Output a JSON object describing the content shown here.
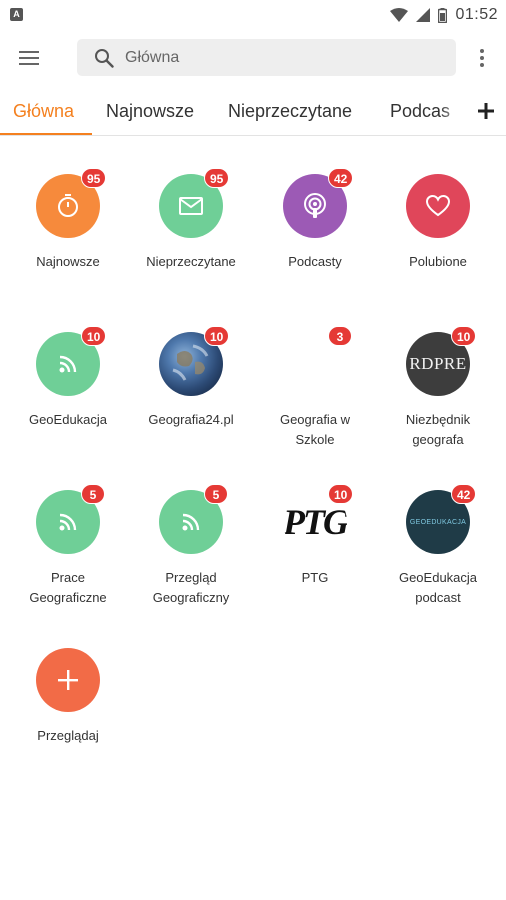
{
  "status_bar": {
    "time": "01:52",
    "left_icon_letter": "A"
  },
  "search": {
    "placeholder": "Główna"
  },
  "tabs": [
    {
      "label": "Główna"
    },
    {
      "label": "Najnowsze"
    },
    {
      "label": "Nieprzeczytane"
    },
    {
      "label": "Podcas"
    }
  ],
  "tiles": [
    {
      "label": "Najnowsze",
      "badge": "95",
      "icon": "timer-icon",
      "color": "#f68a3c"
    },
    {
      "label": "Nieprzeczytane",
      "badge": "95",
      "icon": "mail-icon",
      "color": "#6fcf97"
    },
    {
      "label": "Podcasty",
      "badge": "42",
      "icon": "podcast-icon",
      "color": "#9c5ab5"
    },
    {
      "label": "Polubione",
      "badge": "",
      "icon": "heart-icon",
      "color": "#e0465a"
    },
    {
      "label": "GeoEdukacja",
      "badge": "10",
      "icon": "rss-icon",
      "color": "#6fcf97"
    },
    {
      "label": "Geografia24.pl",
      "badge": "10",
      "icon": "earth-image",
      "color": "#3b5f8f"
    },
    {
      "label": "Geografia w Szkole",
      "badge": "3",
      "icon": "blank-image",
      "color": "#ffffff"
    },
    {
      "label": "Niezbędnik geografa",
      "badge": "10",
      "icon": "wordpress-logo",
      "color": "#3d3d3d",
      "logo_text": "RDPRE"
    },
    {
      "label": "Prace Geograficzne",
      "badge": "5",
      "icon": "rss-icon",
      "color": "#6fcf97"
    },
    {
      "label": "Przegląd Geograficzny",
      "badge": "5",
      "icon": "rss-icon",
      "color": "#6fcf97"
    },
    {
      "label": "PTG",
      "badge": "10",
      "icon": "ptg-logo",
      "color": "#ffffff",
      "logo_text": "PTG"
    },
    {
      "label": "GeoEdukacja podcast",
      "badge": "42",
      "icon": "geoedukacja-logo",
      "color": "#1f3b47",
      "logo_text": "GEOEDUKACJA"
    },
    {
      "label": "Przeglądaj",
      "badge": "",
      "icon": "plus-icon",
      "color": "#f26b47"
    }
  ]
}
